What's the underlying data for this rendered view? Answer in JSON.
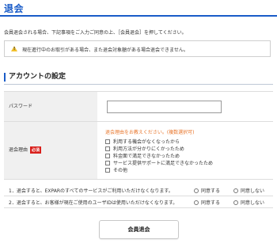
{
  "page": {
    "title": "退会",
    "intro": "会員退会される場合、下記事項をご入力ご同意の上、［会員退会］を押してください。"
  },
  "warning": {
    "icon": "warning-icon",
    "text": "現在進行中のお取引がある場合、また退会対象額がある場合退会できません。"
  },
  "section": {
    "title": "アカウントの設定"
  },
  "form": {
    "password_label": "パスワード",
    "password_value": "",
    "reason_label": "退会理由",
    "required_badge": "必須",
    "reason_note": "退会理由をお教えください。(複数選択可)",
    "reasons": [
      "利用する機会がなくなったから",
      "利用方法が分かりにくかったため",
      "料金面で満足できなかったため",
      "サービス提供サポートに満足できなかったため",
      "その他"
    ]
  },
  "agreements": [
    {
      "question": "1．退会すると、EXPARのすべてのサービスがご利用いただけなくなります。",
      "agree": "同意する",
      "disagree": "同意しない"
    },
    {
      "question": "2．退会すると、お客様が現在ご使用のユーザIDは使用いただけなくなります。",
      "agree": "同意する",
      "disagree": "同意しない"
    }
  ],
  "submit": {
    "label": "会員退会"
  },
  "colors": {
    "accent": "#1a5cc8",
    "required": "#d9201c",
    "note": "#e8762c",
    "warning": "#f2c12e"
  }
}
